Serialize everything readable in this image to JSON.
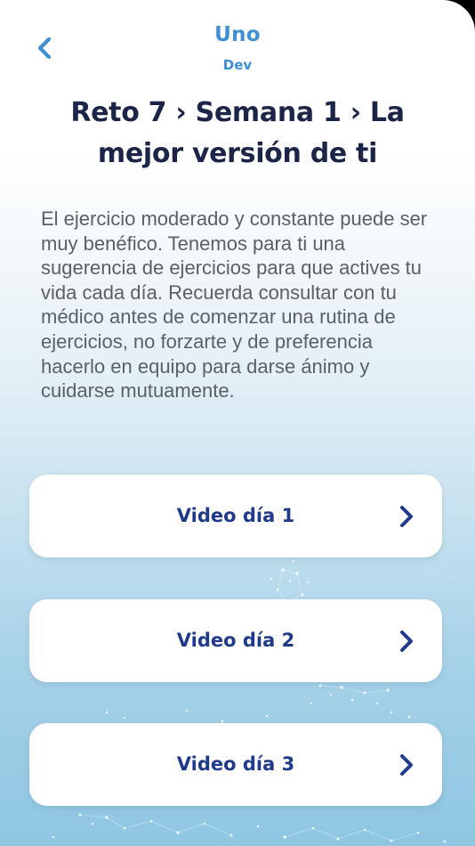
{
  "header": {
    "app_title": "Uno",
    "env_label": "Dev"
  },
  "page": {
    "title": "Reto 7 › Semana 1 › La mejor versión de ti",
    "description": "El ejercicio moderado y constante puede ser muy benéfico. Tenemos para ti una sugerencia de ejercicios para que actives tu vida cada día. Recuerda consultar con tu médico antes de comenzar una rutina de ejercicios, no forzarte y de preferencia hacerlo en equipo para darse ánimo y cuidarse mutuamente."
  },
  "videos": [
    {
      "label": "Video día 1"
    },
    {
      "label": "Video día 2"
    },
    {
      "label": "Video día 3"
    }
  ],
  "icons": {
    "back": "chevron-left-icon",
    "item_arrow": "chevron-right-icon"
  },
  "colors": {
    "accent": "#3d8fd6",
    "title": "#1c2548",
    "card_text": "#1f3a8a",
    "body_text": "#5b5f66"
  }
}
